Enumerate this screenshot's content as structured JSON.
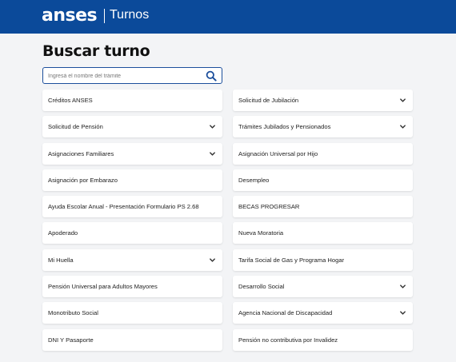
{
  "header": {
    "logo": "anses",
    "subtitle": "Turnos",
    "bar_color": "#0b4a9a"
  },
  "page_title": "Buscar turno",
  "search": {
    "placeholder": "Ingresá el nombre del trámite",
    "icon": "search-icon"
  },
  "left_items": [
    {
      "label": "Créditos ANSES",
      "chevron": false
    },
    {
      "label": "Solicitud de Pensión",
      "chevron": true
    },
    {
      "label": "Asignaciones Familiares",
      "chevron": true
    },
    {
      "label": "Asignación por Embarazo",
      "chevron": false
    },
    {
      "label": "Ayuda Escolar Anual - Presentación Formulario PS 2.68",
      "chevron": false
    },
    {
      "label": "Apoderado",
      "chevron": false
    },
    {
      "label": "Mi Huella",
      "chevron": true
    },
    {
      "label": "Pensión Universal para Adultos Mayores",
      "chevron": false
    },
    {
      "label": "Monotributo Social",
      "chevron": false
    },
    {
      "label": "DNI Y Pasaporte",
      "chevron": false
    }
  ],
  "right_items": [
    {
      "label": "Solicitud de Jubilación",
      "chevron": true
    },
    {
      "label": "Trámites Jubilados y Pensionados",
      "chevron": true
    },
    {
      "label": "Asignación Universal por Hijo",
      "chevron": false
    },
    {
      "label": "Desempleo",
      "chevron": false
    },
    {
      "label": "BECAS PROGRESAR",
      "chevron": false
    },
    {
      "label": "Nueva Moratoria",
      "chevron": false
    },
    {
      "label": "Tarifa Social de Gas y Programa Hogar",
      "chevron": false
    },
    {
      "label": "Desarrollo Social",
      "chevron": true
    },
    {
      "label": "Agencia Nacional de Discapacidad",
      "chevron": true
    },
    {
      "label": "Pensión no contributiva por Invalidez",
      "chevron": false
    }
  ]
}
